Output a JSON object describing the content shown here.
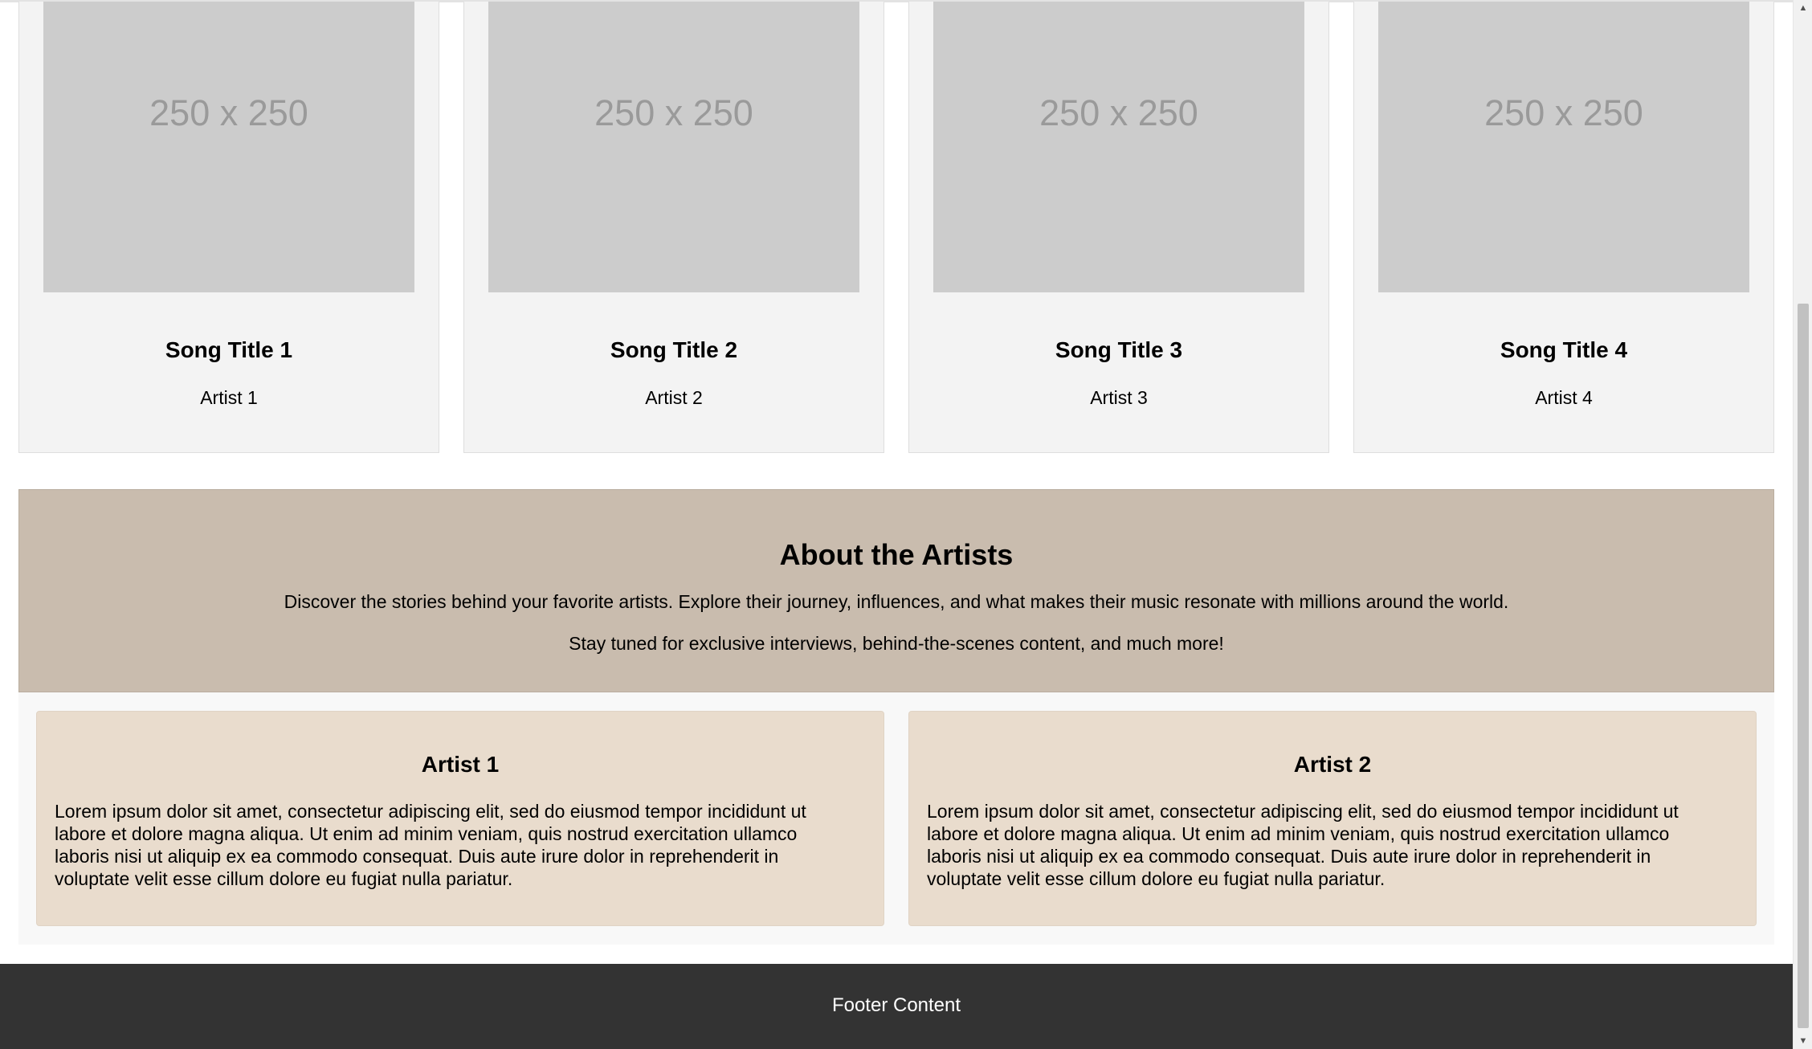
{
  "songs": [
    {
      "cover": "250 x 250",
      "title": "Song Title 1",
      "artist": "Artist 1"
    },
    {
      "cover": "250 x 250",
      "title": "Song Title 2",
      "artist": "Artist 2"
    },
    {
      "cover": "250 x 250",
      "title": "Song Title 3",
      "artist": "Artist 3"
    },
    {
      "cover": "250 x 250",
      "title": "Song Title 4",
      "artist": "Artist 4"
    }
  ],
  "about": {
    "heading": "About the Artists",
    "paragraph1": "Discover the stories behind your favorite artists. Explore their journey, influences, and what makes their music resonate with millions around the world.",
    "paragraph2": "Stay tuned for exclusive interviews, behind-the-scenes content, and much more!"
  },
  "artists": [
    {
      "name": "Artist 1",
      "bio": "Lorem ipsum dolor sit amet, consectetur adipiscing elit, sed do eiusmod tempor incididunt ut labore et dolore magna aliqua. Ut enim ad minim veniam, quis nostrud exercitation ullamco laboris nisi ut aliquip ex ea commodo consequat. Duis aute irure dolor in reprehenderit in voluptate velit esse cillum dolore eu fugiat nulla pariatur."
    },
    {
      "name": "Artist 2",
      "bio": "Lorem ipsum dolor sit amet, consectetur adipiscing elit, sed do eiusmod tempor incididunt ut labore et dolore magna aliqua. Ut enim ad minim veniam, quis nostrud exercitation ullamco laboris nisi ut aliquip ex ea commodo consequat. Duis aute irure dolor in reprehenderit in voluptate velit esse cillum dolore eu fugiat nulla pariatur."
    }
  ],
  "footer": {
    "text": "Footer Content"
  },
  "scrollbar": {
    "up_icon": "arrow-up-icon",
    "down_icon": "arrow-down-icon"
  },
  "colors": {
    "card_bg": "#f3f3f3",
    "cover_placeholder": "#cccccc",
    "about_bg": "#c9bcae",
    "artist_card_bg": "#e9dccd",
    "footer_bg": "#333333"
  }
}
